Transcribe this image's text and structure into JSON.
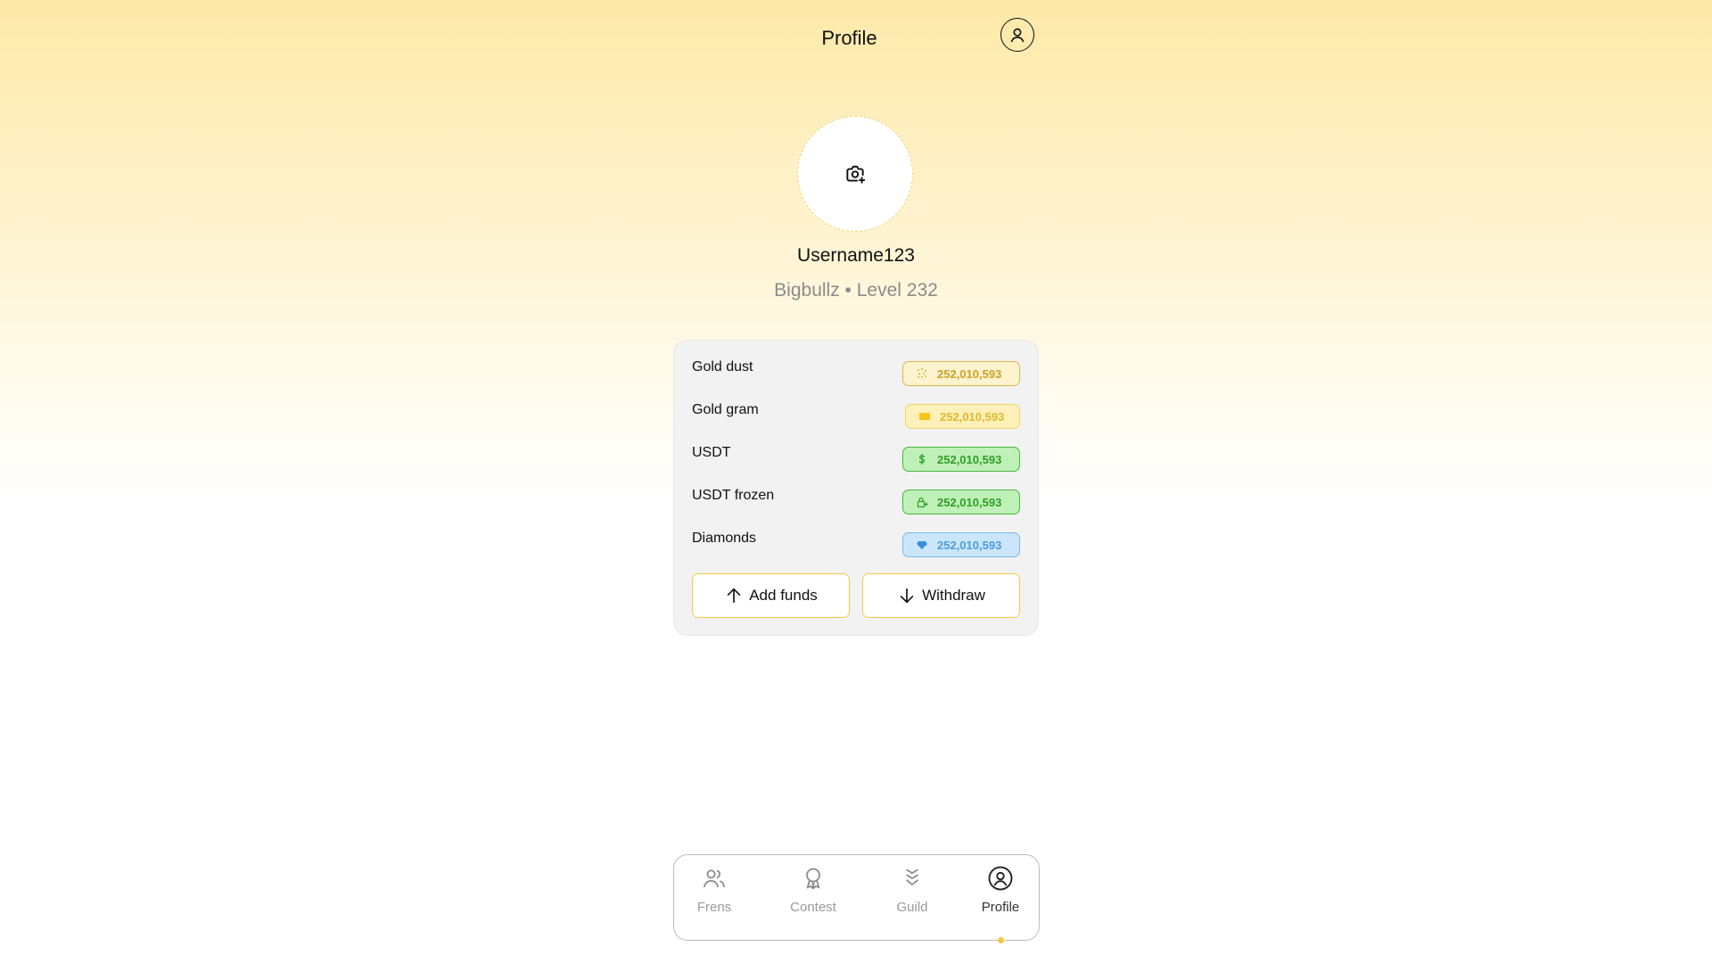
{
  "header": {
    "title": "Profile",
    "avatar_icon": "user-circle-icon"
  },
  "profile": {
    "avatar_upload_icon": "camera-plus-icon",
    "username": "Username123",
    "subtitle": "Bigbullz • Level 232"
  },
  "wallet": {
    "rows": [
      {
        "label": "Gold dust",
        "value": "252,010,593",
        "icon": "gold-dust-icon",
        "color": "#c9a227"
      },
      {
        "label": "Gold gram",
        "value": "252,010,593",
        "icon": "gold-bar-icon",
        "color": "#e0b92f"
      },
      {
        "label": "USDT",
        "value": "252,010,593",
        "icon": "dollar-icon",
        "color": "#2e9f27"
      },
      {
        "label": "USDT frozen",
        "value": "252,010,593",
        "icon": "lock-icon",
        "color": "#2e9f27"
      },
      {
        "label": "Diamonds",
        "value": "252,010,593",
        "icon": "diamond-icon",
        "color": "#4a9be0"
      }
    ],
    "add_funds_label": "Add funds",
    "withdraw_label": "Withdraw",
    "accent": "#f5c842"
  },
  "nav": {
    "items": [
      {
        "label": "Frens",
        "icon": "users-icon"
      },
      {
        "label": "Contest",
        "icon": "award-icon"
      },
      {
        "label": "Guild",
        "icon": "chevrons-down-icon"
      },
      {
        "label": "Profile",
        "icon": "user-circle-icon",
        "active": true
      }
    ]
  }
}
